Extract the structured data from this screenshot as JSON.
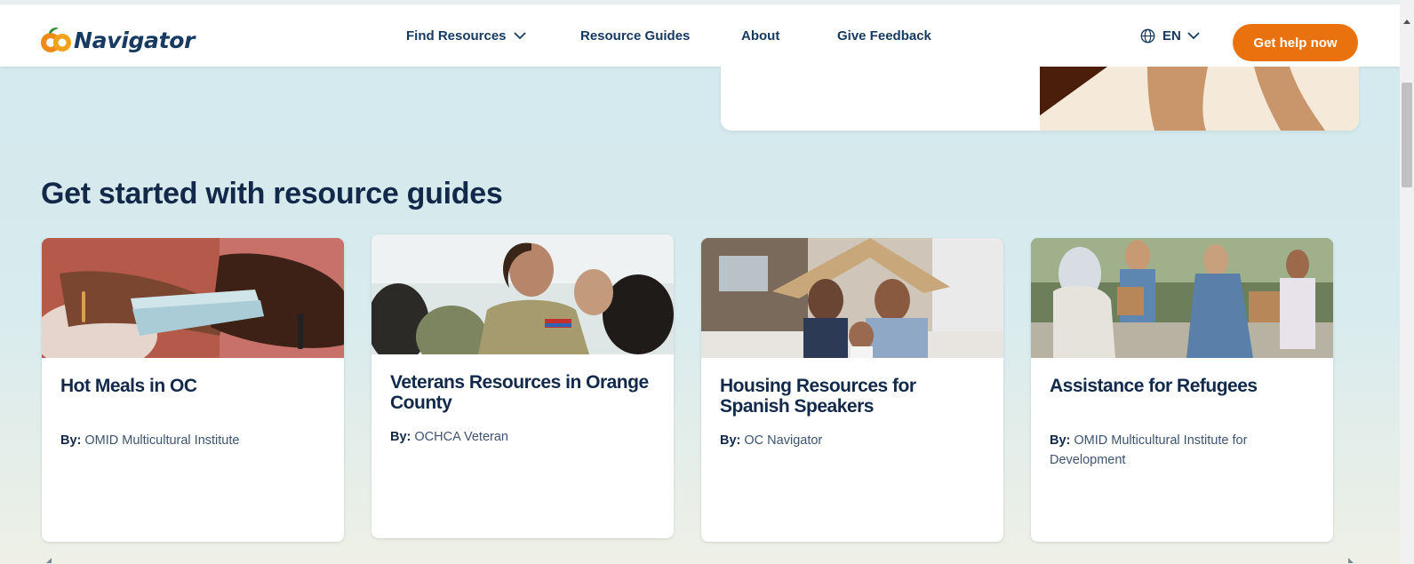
{
  "header": {
    "logo_text": "Navigator",
    "nav": {
      "find_resources": "Find Resources",
      "resource_guides": "Resource Guides",
      "about": "About",
      "give_feedback": "Give Feedback"
    },
    "language": "EN",
    "cta_label": "Get help now"
  },
  "section": {
    "title": "Get started with resource guides"
  },
  "cards": [
    {
      "title": "Hot Meals in OC",
      "by_label": "By:",
      "author": "OMID Multicultural Institute"
    },
    {
      "title": "Veterans Resources in Orange County",
      "by_label": "By:",
      "author": "OCHCA Veteran"
    },
    {
      "title": "Housing Resources for Spanish Speakers",
      "by_label": "By:",
      "author": "OC Navigator"
    },
    {
      "title": "Assistance for Refugees",
      "by_label": "By:",
      "author": "OMID Multicultural Institute for Development"
    }
  ],
  "colors": {
    "brand_navy": "#163a61",
    "accent_orange": "#e9720f",
    "page_bg": "#d3e9ee"
  },
  "icons": [
    "logo-oranges-icon",
    "chevron-down-icon",
    "globe-icon"
  ]
}
